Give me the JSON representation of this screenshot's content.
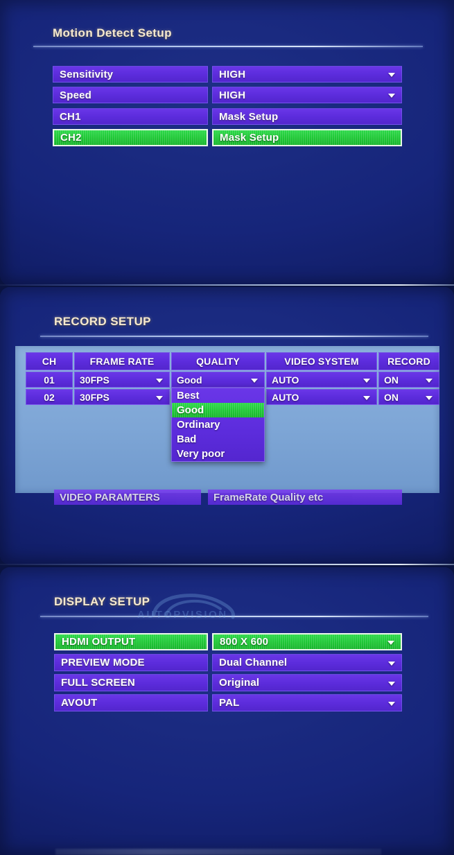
{
  "colors": {
    "screen_bg": "#16257a",
    "row_purple": "#5c2cdc",
    "row_selected_green": "#1fc836",
    "title_cream": "#f6e9cf",
    "table_panel_blue": "#7ea6d6"
  },
  "motion_detect": {
    "title": "Motion Detect Setup",
    "rows": [
      {
        "label": "Sensitivity",
        "value": "HIGH",
        "has_caret": true,
        "selected": false
      },
      {
        "label": "Speed",
        "value": "HIGH",
        "has_caret": true,
        "selected": false
      },
      {
        "label": "CH1",
        "value": "Mask Setup",
        "has_caret": false,
        "selected": false
      },
      {
        "label": "CH2",
        "value": "Mask Setup",
        "has_caret": false,
        "selected": true
      }
    ]
  },
  "record_setup": {
    "title": "RECORD SETUP",
    "columns": [
      "CH",
      "FRAME RATE",
      "QUALITY",
      "VIDEO SYSTEM",
      "RECORD"
    ],
    "rows": [
      {
        "ch": "01",
        "frame_rate": "30FPS",
        "quality": "Good",
        "video_system": "AUTO",
        "record": "ON"
      },
      {
        "ch": "02",
        "frame_rate": "30FPS",
        "quality": "",
        "video_system": "AUTO",
        "record": "ON"
      }
    ],
    "open_dropdown": {
      "column": "QUALITY",
      "row": "01",
      "options": [
        "Best",
        "Good",
        "Ordinary",
        "Bad",
        "Very poor"
      ],
      "selected": "Good"
    },
    "partial_row": {
      "label": "VIDEO PARAMTERS",
      "value": "FrameRate Quality etc"
    }
  },
  "display_setup": {
    "title": "DISPLAY SETUP",
    "rows": [
      {
        "label": "HDMI OUTPUT",
        "value": "800 X 600",
        "has_caret": true,
        "selected": true
      },
      {
        "label": "PREVIEW MODE",
        "value": "Dual Channel",
        "has_caret": true,
        "selected": false
      },
      {
        "label": "FULL SCREEN",
        "value": "Original",
        "has_caret": true,
        "selected": false
      },
      {
        "label": "AVOUT",
        "value": "PAL",
        "has_caret": true,
        "selected": false
      }
    ],
    "watermark": "AUTOPVISION"
  }
}
